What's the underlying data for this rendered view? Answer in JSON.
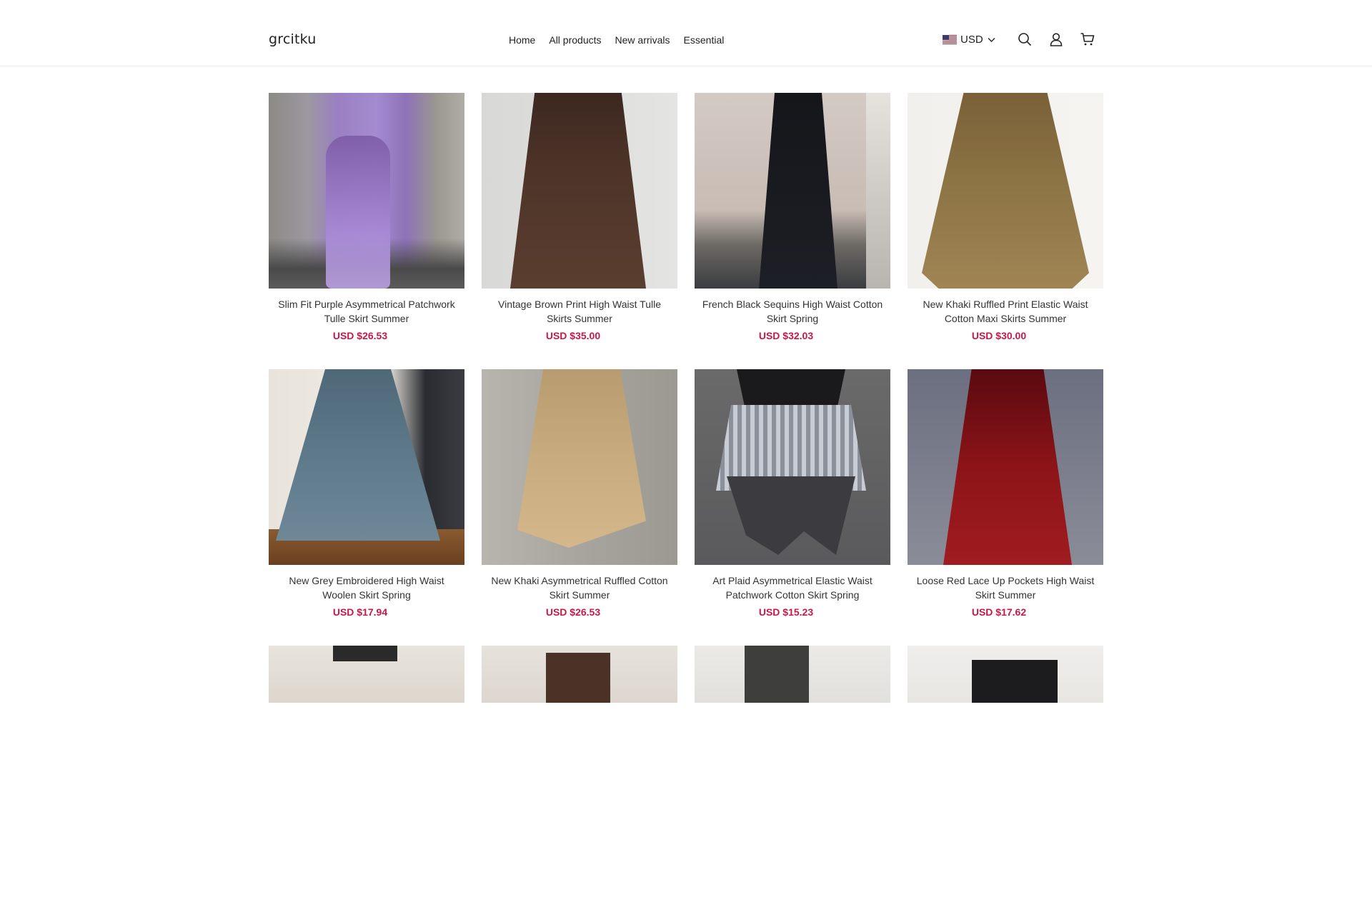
{
  "header": {
    "logo": "grcitku",
    "nav": [
      "Home",
      "All products",
      "New arrivals",
      "Essential"
    ],
    "currency": "USD",
    "icons": [
      "search-icon",
      "account-icon",
      "cart-icon"
    ]
  },
  "products": [
    {
      "title": "Slim Fit Purple Asymmetrical Patchwork Tulle Skirt Summer",
      "price": "USD $26.53"
    },
    {
      "title": "Vintage Brown Print High Waist Tulle Skirts Summer",
      "price": "USD $35.00"
    },
    {
      "title": "French Black Sequins High Waist Cotton Skirt Spring",
      "price": "USD $32.03"
    },
    {
      "title": "New Khaki Ruffled Print Elastic Waist Cotton Maxi Skirts Summer",
      "price": "USD $30.00"
    },
    {
      "title": "New Grey Embroidered High Waist Woolen Skirt Spring",
      "price": "USD $17.94"
    },
    {
      "title": "New Khaki Asymmetrical Ruffled Cotton Skirt Summer",
      "price": "USD $26.53"
    },
    {
      "title": "Art Plaid Asymmetrical Elastic Waist Patchwork Cotton Skirt Spring",
      "price": "USD $15.23"
    },
    {
      "title": "Loose Red Lace Up Pockets High Waist Skirt Summer",
      "price": "USD $17.62"
    }
  ],
  "colors": {
    "price": "#c8184a",
    "text": "#222222",
    "border": "#ececec"
  }
}
